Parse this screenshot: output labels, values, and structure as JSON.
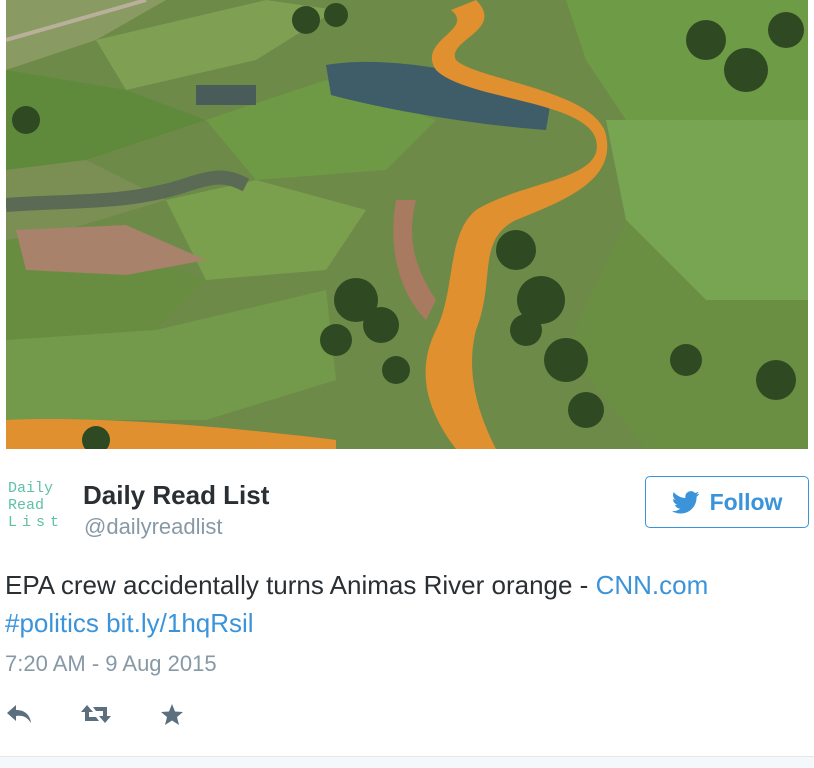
{
  "photo": {
    "subject": "aerial-river-orange"
  },
  "author": {
    "logo_lines": [
      "Daily",
      "Read",
      "List"
    ],
    "name": "Daily Read List",
    "handle": "@dailyreadlist"
  },
  "follow": {
    "label": "Follow",
    "icon": "bird-icon"
  },
  "tweet": {
    "text": "EPA crew accidentally turns Animas River orange - ",
    "source_link": "CNN.com",
    "hashtag": "#politics",
    "short_link": "bit.ly/1hqRsil"
  },
  "timestamp": "7:20 AM - 9 Aug 2015",
  "actions": [
    {
      "name": "reply",
      "icon": "reply-icon"
    },
    {
      "name": "retweet",
      "icon": "retweet-icon"
    },
    {
      "name": "favorite",
      "icon": "star-icon"
    }
  ],
  "colors": {
    "link": "#3b94d9",
    "muted": "#8899a6",
    "text": "#292f33",
    "logo": "#5ec0a8",
    "river": "#e0902e"
  }
}
